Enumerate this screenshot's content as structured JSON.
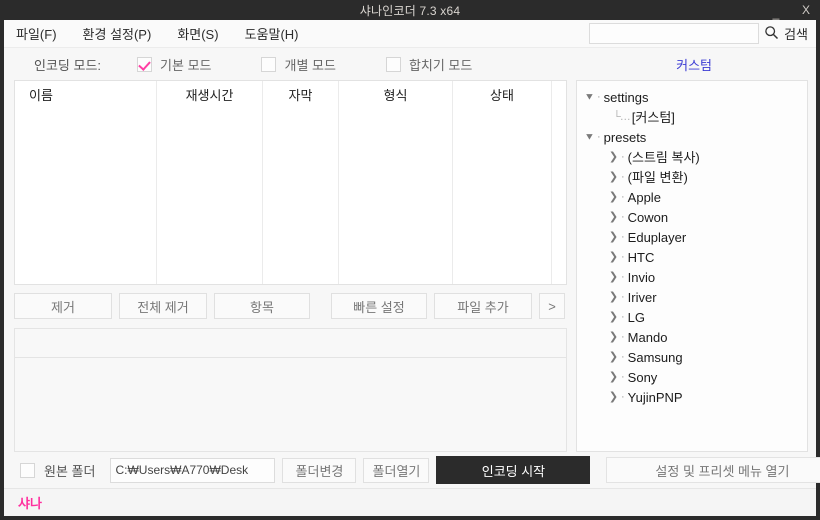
{
  "titlebar": {
    "title": "샤나인코더 7.3 x64",
    "minimize": "_",
    "close": "X"
  },
  "menu": {
    "items": [
      {
        "label": "파일(F)"
      },
      {
        "label": "환경 설정(P)"
      },
      {
        "label": "화면(S)"
      },
      {
        "label": "도움말(H)"
      }
    ]
  },
  "search": {
    "value": "",
    "placeholder": "",
    "label": "검색",
    "icon": "search-icon"
  },
  "mode_row": {
    "label": "인코딩 모드:",
    "checkboxes": [
      {
        "label": "기본 모드",
        "checked": true
      },
      {
        "label": "개별 모드",
        "checked": false
      },
      {
        "label": "합치기 모드",
        "checked": false
      }
    ],
    "custom_link": "커스텀",
    "custom_color": "#3b3bd4",
    "check_color": "#ff3fa4"
  },
  "file_table": {
    "columns": [
      "이름",
      "재생시간",
      "자막",
      "형식",
      "상태",
      ""
    ],
    "rows": []
  },
  "action_buttons": [
    {
      "label": "제거"
    },
    {
      "label": "전체 제거"
    },
    {
      "label": "항목"
    },
    {
      "label": "빠른 설정"
    },
    {
      "label": "파일 추가"
    },
    {
      "label": ">"
    }
  ],
  "tree": {
    "nodes": [
      {
        "label": "settings",
        "level": 0,
        "expanded": true,
        "chevron": "v"
      },
      {
        "label": "[커스텀]",
        "level": 2,
        "leaf": true
      },
      {
        "label": "presets",
        "level": 0,
        "expanded": true,
        "chevron": "v"
      },
      {
        "label": "(스트림 복사)",
        "level": 1,
        "chevron": ">"
      },
      {
        "label": "(파일 변환)",
        "level": 1,
        "chevron": ">"
      },
      {
        "label": "Apple",
        "level": 1,
        "chevron": ">"
      },
      {
        "label": "Cowon",
        "level": 1,
        "chevron": ">"
      },
      {
        "label": "Eduplayer",
        "level": 1,
        "chevron": ">"
      },
      {
        "label": "HTC",
        "level": 1,
        "chevron": ">"
      },
      {
        "label": "Invio",
        "level": 1,
        "chevron": ">"
      },
      {
        "label": "Iriver",
        "level": 1,
        "chevron": ">"
      },
      {
        "label": "LG",
        "level": 1,
        "chevron": ">"
      },
      {
        "label": "Mando",
        "level": 1,
        "chevron": ">"
      },
      {
        "label": "Samsung",
        "level": 1,
        "chevron": ">"
      },
      {
        "label": "Sony",
        "level": 1,
        "chevron": ">"
      },
      {
        "label": "YujinPNP",
        "level": 1,
        "chevron": ">"
      }
    ]
  },
  "bottom_bar": {
    "source_folder_label": "원본 폴더",
    "source_folder_checked": false,
    "path_value": "C:₩Users₩A770₩Desk",
    "change_folder_label": "폴더변경",
    "open_folder_label": "폴더열기",
    "start_label": "인코딩 시작",
    "start_bg": "#2b2b2b",
    "preset_menu_label": "설정 및 프리셋 메뉴 열기"
  },
  "status_bar": {
    "text": "샤나",
    "color": "#ff2f9e"
  }
}
